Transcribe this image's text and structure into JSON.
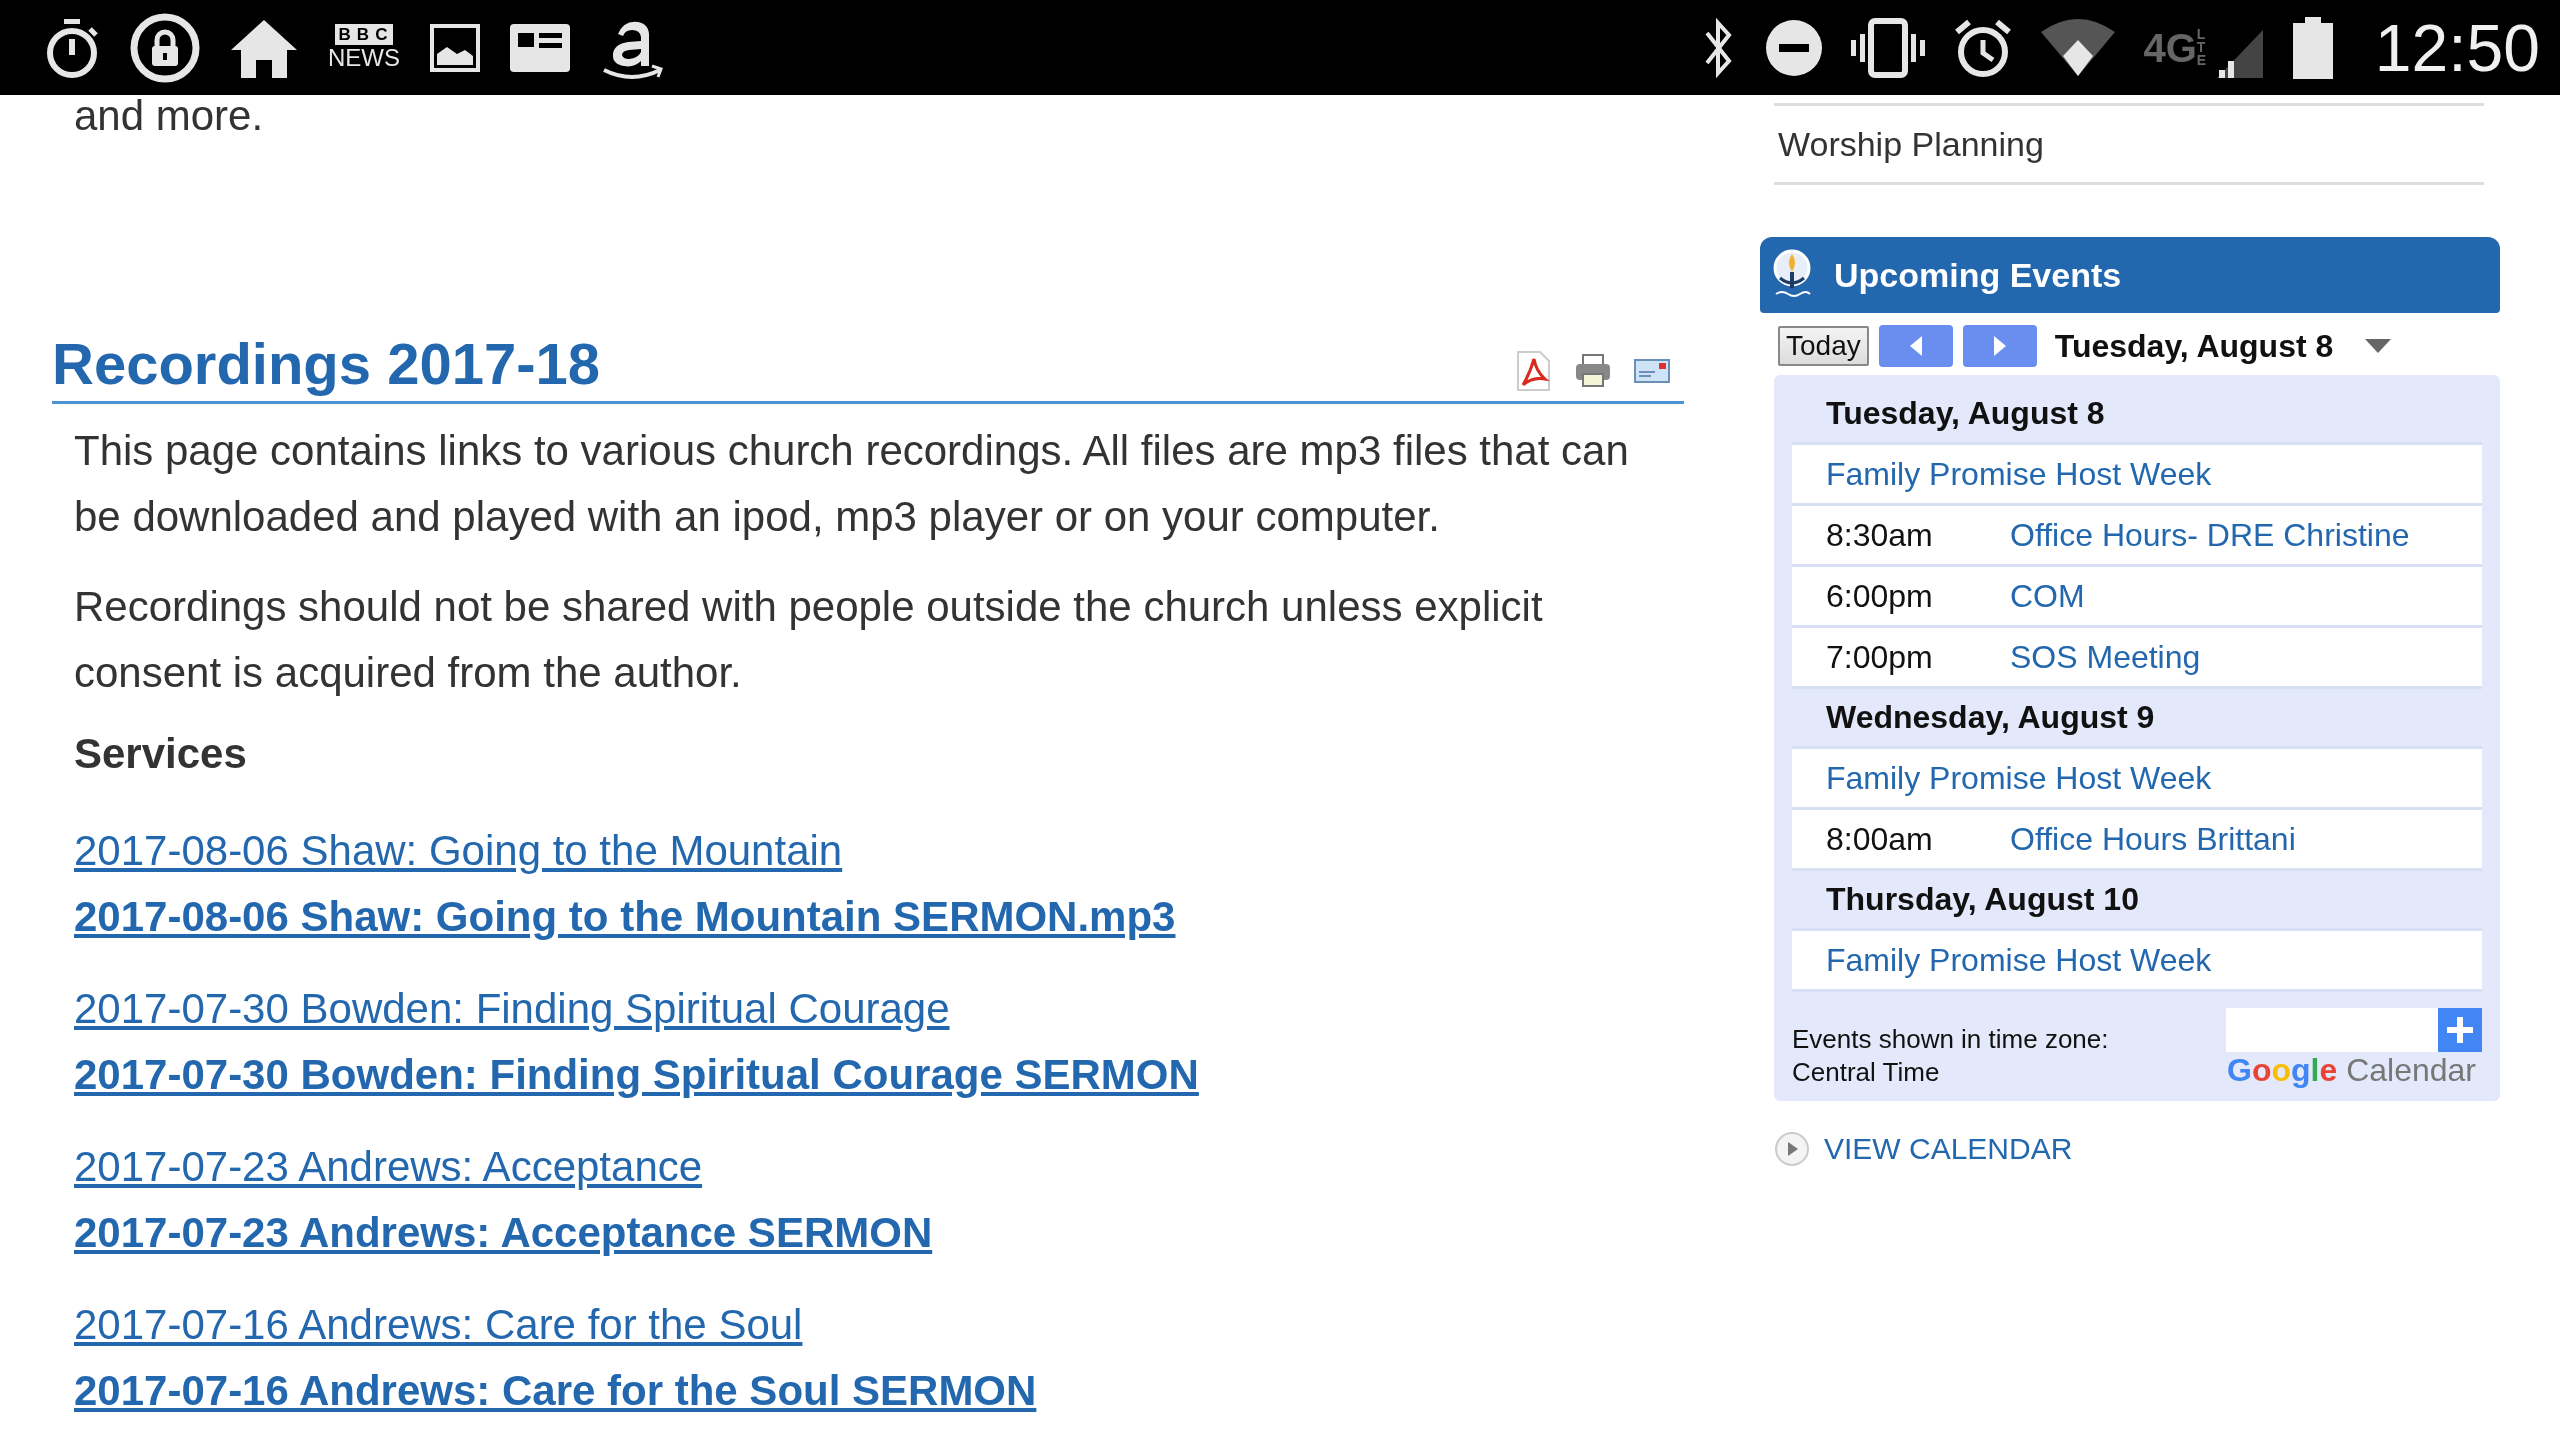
{
  "status_bar": {
    "news_logo_top": "BBC",
    "news_logo_bottom": "NEWS",
    "network": "4G",
    "network_sub": "LTE",
    "time": "12:50"
  },
  "content": {
    "intro_fragment": "and more.",
    "title": "Recordings 2017-18",
    "paragraphs": [
      "This page contains links to various church recordings. All files are mp3 files that can be downloaded and played with an ipod, mp3 player or on your computer.",
      "Recordings should not be shared with people outside the church unless explicit consent is acquired from the author."
    ],
    "section_heading": "Services",
    "recordings": [
      {
        "link": "2017-08-06 Shaw: Going to the Mountain",
        "sermon_link": "2017-08-06 Shaw: Going to the Mountain SERMON.mp3"
      },
      {
        "link": "2017-07-30 Bowden: Finding Spiritual Courage",
        "sermon_link": "2017-07-30 Bowden: Finding Spiritual Courage SERMON"
      },
      {
        "link": "2017-07-23 Andrews: Acceptance",
        "sermon_link": "2017-07-23 Andrews: Acceptance SERMON"
      },
      {
        "link": "2017-07-16 Andrews: Care for the Soul",
        "sermon_link": "2017-07-16 Andrews: Care for the Soul SERMON"
      }
    ]
  },
  "sidebar": {
    "menu_items": [
      "Worship Planning"
    ],
    "events": {
      "title": "Upcoming Events",
      "today_button": "Today",
      "current_date": "Tuesday, August 8",
      "days": [
        {
          "date": "Tuesday, August 8",
          "events": [
            {
              "title": "Family Promise Host Week"
            },
            {
              "time": "8:30am",
              "title": "Office Hours- DRE Christine"
            },
            {
              "time": "6:00pm",
              "title": "COM"
            },
            {
              "time": "7:00pm",
              "title": "SOS Meeting"
            }
          ]
        },
        {
          "date": "Wednesday, August 9",
          "events": [
            {
              "title": "Family Promise Host Week"
            },
            {
              "time": "8:00am",
              "title": "Office Hours Brittani"
            }
          ]
        },
        {
          "date": "Thursday, August 10",
          "events": [
            {
              "title": "Family Promise Host Week"
            }
          ]
        }
      ],
      "timezone_label": "Events shown in time zone:",
      "timezone": "Central Time",
      "logo_word": "Google",
      "logo_suffix": "Calendar"
    },
    "view_calendar": "VIEW CALENDAR"
  }
}
